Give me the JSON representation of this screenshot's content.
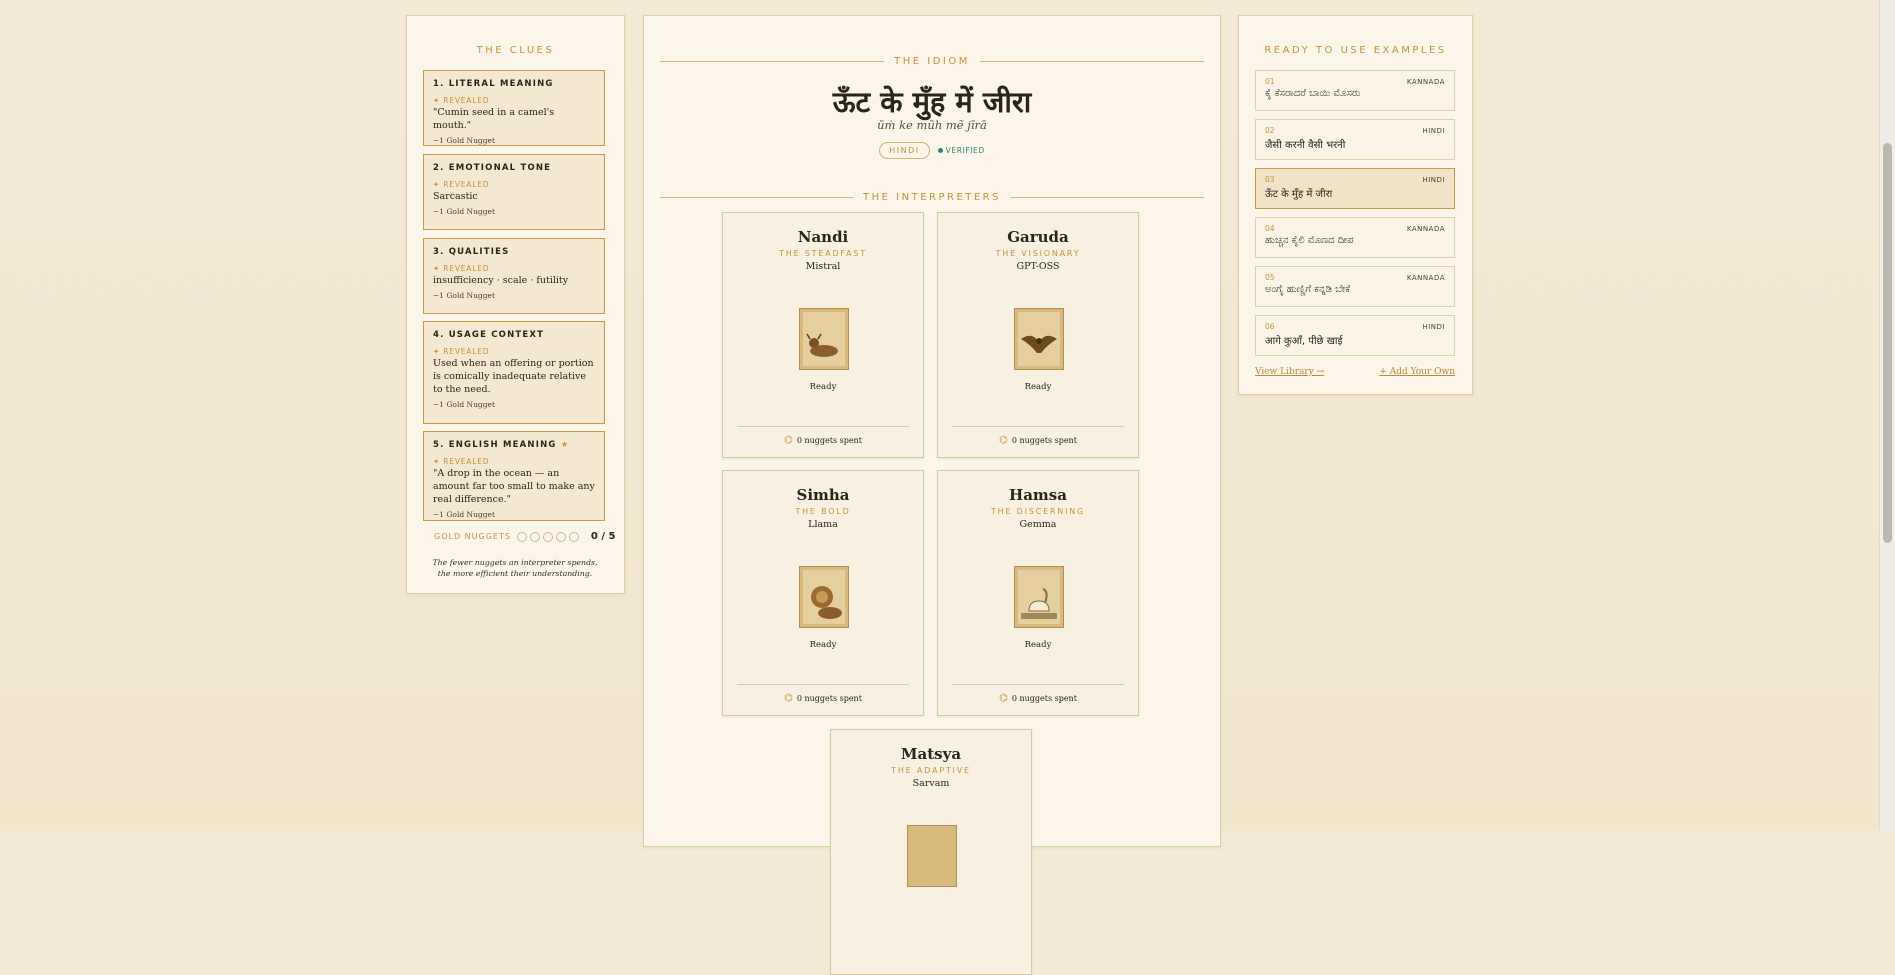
{
  "clues": {
    "title": "THE CLUES",
    "revealed_label": "✦ REVEALED",
    "items": [
      {
        "title": "1. LITERAL MEANING",
        "value": "\"Cumin seed in a camel's mouth.\"",
        "cost": "−1 Gold Nugget"
      },
      {
        "title": "2. EMOTIONAL TONE",
        "value": "Sarcastic",
        "cost": "−1 Gold Nugget"
      },
      {
        "title": "3. QUALITIES",
        "value": "insufficiency · scale · futility",
        "cost": "−1 Gold Nugget"
      },
      {
        "title": "4. USAGE CONTEXT",
        "value": "Used when an offering or portion is comically inadequate relative to the need.",
        "cost": "−1 Gold Nugget"
      },
      {
        "title": "5. ENGLISH MEANING",
        "star": "★",
        "value": "\"A drop in the ocean — an amount far too small to make any real difference.\"",
        "cost": "−1 Gold Nugget"
      }
    ],
    "nuggets_label": "GOLD NUGGETS",
    "nuggets_count": "0 / 5",
    "nuggets_total": 5,
    "note": "The fewer nuggets an interpreter spends, the more efficient their understanding."
  },
  "idiom": {
    "section_title": "THE IDIOM",
    "text": "ऊँट के मुँह में जीरा",
    "transliteration": "ūṁ ke mūh mẽ jīrā",
    "language": "HINDI",
    "verified": "VERIFIED"
  },
  "interpreters": {
    "section_title": "THE INTERPRETERS",
    "items": [
      {
        "name": "Nandi",
        "epithet": "THE STEADFAST",
        "model": "Mistral",
        "status": "Ready",
        "spent": "0 nuggets spent",
        "icon": "bull-icon"
      },
      {
        "name": "Garuda",
        "epithet": "THE VISIONARY",
        "model": "GPT-OSS",
        "status": "Ready",
        "spent": "0 nuggets spent",
        "icon": "eagle-icon"
      },
      {
        "name": "Simha",
        "epithet": "THE BOLD",
        "model": "Llama",
        "status": "Ready",
        "spent": "0 nuggets spent",
        "icon": "lion-icon"
      },
      {
        "name": "Hamsa",
        "epithet": "THE DISCERNING",
        "model": "Gemma",
        "status": "Ready",
        "spent": "0 nuggets spent",
        "icon": "swan-icon"
      },
      {
        "name": "Matsya",
        "epithet": "THE ADAPTIVE",
        "model": "Sarvam",
        "status": "",
        "spent": "",
        "icon": "fish-icon"
      }
    ]
  },
  "examples": {
    "title": "READY TO USE EXAMPLES",
    "items": [
      {
        "num": "01",
        "lang": "KANNADA",
        "text": "ಕೈ ಕೆಸರಾದರೆ ಬಾಯಿ ಮೊಸರು"
      },
      {
        "num": "02",
        "lang": "HINDI",
        "text": "जैसी करनी वैसी भरनी"
      },
      {
        "num": "03",
        "lang": "HINDI",
        "text": "ऊँट के मुँह में जीरा"
      },
      {
        "num": "04",
        "lang": "KANNADA",
        "text": "ಹುಚ್ಚನ ಕೈಲಿ ಮೊಣದ ದೀಪ"
      },
      {
        "num": "05",
        "lang": "KANNADA",
        "text": "ಅಂಗೈ ಹುಣ್ಣಿಗೆ ಕನ್ನಡಿ ಬೇಕೆ"
      },
      {
        "num": "06",
        "lang": "HINDI",
        "text": "आगे कुआँ, पीछे खाई"
      }
    ],
    "active_index": 2,
    "view_library": "View Library →",
    "add_your_own": "+ Add Your Own"
  },
  "colors": {
    "accent": "#c7923a",
    "verified": "#2b8a74",
    "background": "#f4ead6"
  }
}
